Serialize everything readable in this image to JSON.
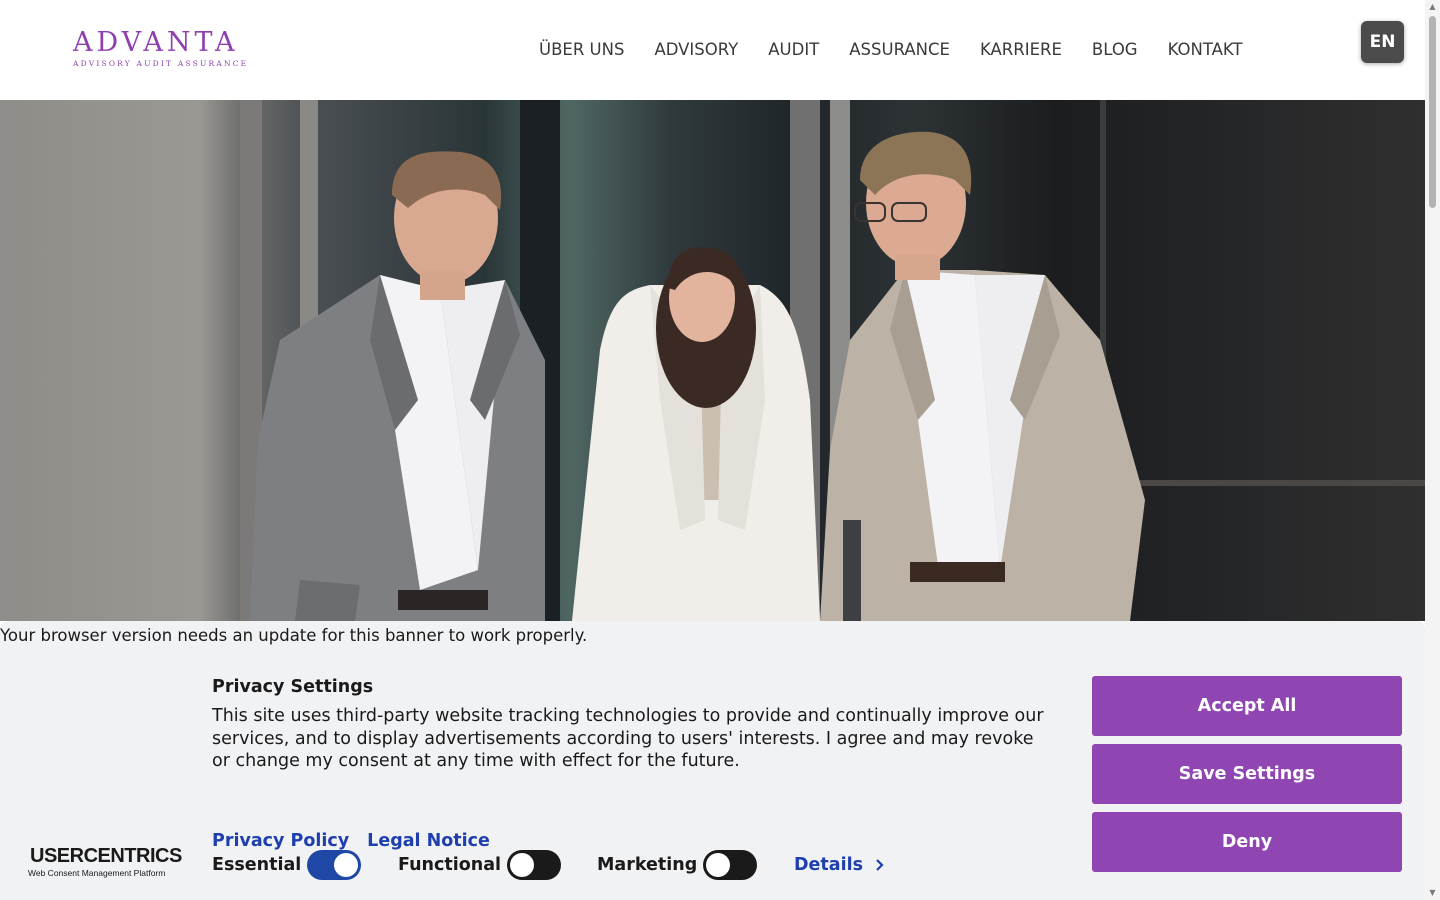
{
  "header": {
    "logo": {
      "main": "ADVANTA",
      "sub": "ADVISORY AUDIT ASSURANCE"
    },
    "nav": [
      {
        "label": "ÜBER UNS"
      },
      {
        "label": "ADVISORY"
      },
      {
        "label": "AUDIT"
      },
      {
        "label": "ASSURANCE"
      },
      {
        "label": "KARRIERE"
      },
      {
        "label": "BLOG"
      },
      {
        "label": "KONTAKT"
      }
    ],
    "language_button": "EN"
  },
  "hero": {
    "image": "photo of three business professionals walking and talking in front of a dark glass building"
  },
  "consent": {
    "browser_note": "Your browser version needs an update for this banner to work properly.",
    "brand": {
      "name": "USERCENTRICS",
      "tagline": "Web Consent Management Platform"
    },
    "title": "Privacy Settings",
    "text": "This site uses third-party website tracking technologies to provide and continually improve our services, and to display advertisements according to users' interests. I agree and may revoke or change my consent at any time with effect for the future.",
    "links": {
      "privacy_policy": "Privacy Policy",
      "legal_notice": "Legal Notice"
    },
    "toggles": [
      {
        "label": "Essential",
        "on": true
      },
      {
        "label": "Functional",
        "on": false
      },
      {
        "label": "Marketing",
        "on": false
      }
    ],
    "details_label": "Details",
    "buttons": {
      "accept_all": "Accept All",
      "save_settings": "Save Settings",
      "deny": "Deny"
    },
    "colors": {
      "primary_button": "#8f45b2",
      "link": "#1f3fae",
      "toggle_on": "#1f47a5",
      "toggle_off": "#1a1a1a",
      "banner_bg": "#f1f2f4"
    }
  }
}
